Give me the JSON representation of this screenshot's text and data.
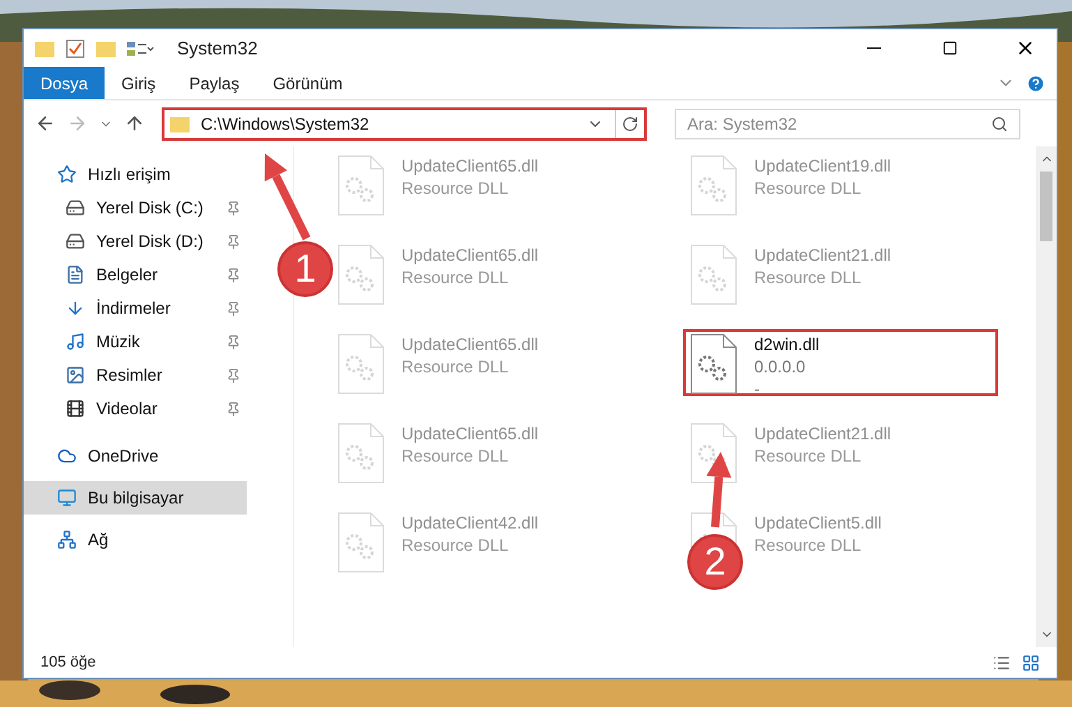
{
  "window": {
    "title": "System32"
  },
  "ribbon_tabs": [
    {
      "label": "Dosya",
      "selected": true
    },
    {
      "label": "Giriş",
      "selected": false
    },
    {
      "label": "Paylaş",
      "selected": false
    },
    {
      "label": "Görünüm",
      "selected": false
    }
  ],
  "address": {
    "value": "C:\\Windows\\System32",
    "highlighted": true
  },
  "search": {
    "placeholder": "Ara: System32"
  },
  "sidebar": {
    "items": [
      {
        "label": "Hızlı erişim",
        "selected": false,
        "children": [
          {
            "label": "Yerel Disk (C:)",
            "pinned": true,
            "selected": false
          },
          {
            "label": "Yerel Disk (D:)",
            "pinned": true,
            "selected": false
          },
          {
            "label": "Belgeler",
            "pinned": true,
            "selected": false
          },
          {
            "label": "İndirmeler",
            "pinned": true,
            "selected": false
          },
          {
            "label": "Müzik",
            "pinned": true,
            "selected": false
          },
          {
            "label": "Resimler",
            "pinned": true,
            "selected": false
          },
          {
            "label": "Videolar",
            "pinned": true,
            "selected": false
          }
        ]
      },
      {
        "label": "OneDrive",
        "selected": false
      },
      {
        "label": "Bu bilgisayar",
        "selected": true
      },
      {
        "label": "Ağ",
        "selected": false
      }
    ]
  },
  "files": [
    {
      "name": "UpdateClient65.dll",
      "lines": [
        "Resource DLL"
      ],
      "dimmed": true,
      "highlighted": false
    },
    {
      "name": "UpdateClient19.dll",
      "lines": [
        "Resource DLL"
      ],
      "dimmed": true,
      "highlighted": false
    },
    {
      "name": "UpdateClient65.dll",
      "lines": [
        "Resource DLL"
      ],
      "dimmed": true,
      "highlighted": false
    },
    {
      "name": "UpdateClient21.dll",
      "lines": [
        "Resource DLL"
      ],
      "dimmed": true,
      "highlighted": false
    },
    {
      "name": "UpdateClient65.dll",
      "lines": [
        "Resource DLL"
      ],
      "dimmed": true,
      "highlighted": false
    },
    {
      "name": "d2win.dll",
      "lines": [
        "0.0.0.0",
        "-"
      ],
      "dimmed": false,
      "highlighted": true
    },
    {
      "name": "UpdateClient65.dll",
      "lines": [
        "Resource DLL"
      ],
      "dimmed": true,
      "highlighted": false
    },
    {
      "name": "UpdateClient21.dll",
      "lines": [
        "Resource DLL"
      ],
      "dimmed": true,
      "highlighted": false
    },
    {
      "name": "UpdateClient42.dll",
      "lines": [
        "Resource DLL"
      ],
      "dimmed": true,
      "highlighted": false
    },
    {
      "name": "UpdateClient5.dll",
      "lines": [
        "Resource DLL"
      ],
      "dimmed": true,
      "highlighted": false
    }
  ],
  "status_bar": {
    "count": "105 öğe"
  },
  "callouts": [
    {
      "number": "1"
    },
    {
      "number": "2"
    }
  ]
}
